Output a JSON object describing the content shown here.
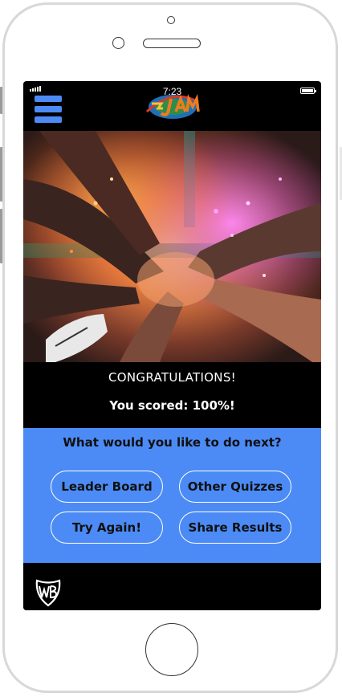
{
  "status_bar": {
    "time": "7:23"
  },
  "header": {
    "menu_icon": "hamburger-menu-icon",
    "logo_alt": "Space Jam"
  },
  "result": {
    "title": "CONGRATULATIONS!",
    "score_text": "You scored: 100%!"
  },
  "actions": {
    "title": "What would you like to do next?",
    "leader_board": "Leader Board",
    "other_quizzes": "Other Quizzes",
    "try_again": "Try Again!",
    "share_results": "Share Results"
  },
  "footer": {
    "logo_icon": "wb-shield-icon"
  },
  "colors": {
    "accent_blue": "#4c8bf5",
    "screen_bg": "#000000",
    "button_border": "#ffffff"
  }
}
